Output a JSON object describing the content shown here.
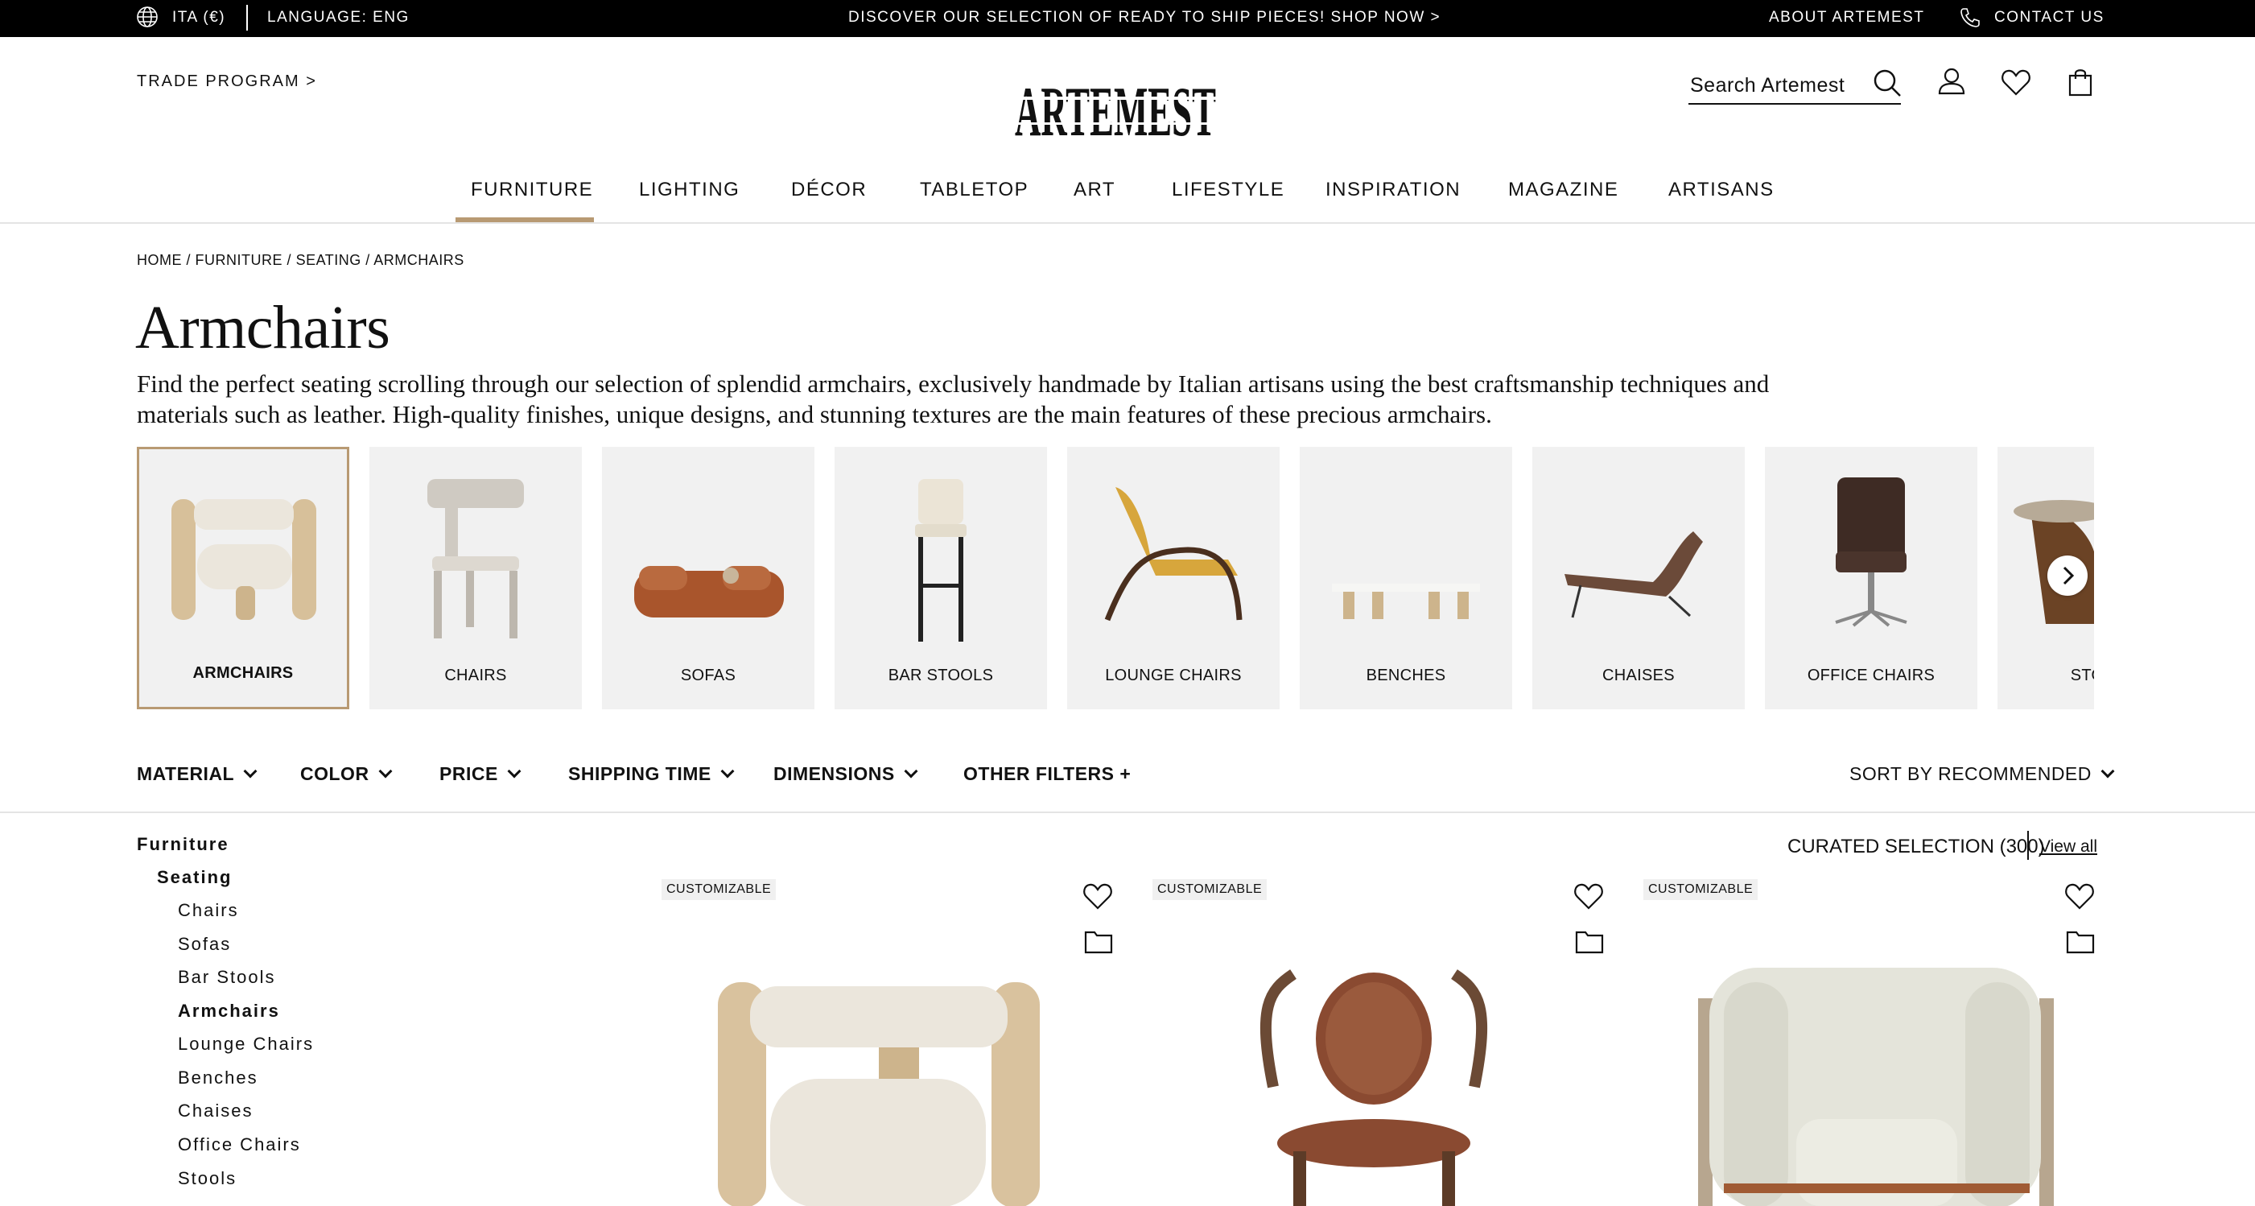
{
  "topbar": {
    "region": "ITA (€)",
    "language": "LANGUAGE: ENG",
    "promo": "DISCOVER OUR SELECTION OF READY TO SHIP PIECES! SHOP NOW >",
    "about": "ABOUT ARTEMEST",
    "contact": "CONTACT US"
  },
  "header": {
    "trade": "TRADE PROGRAM >",
    "logo": "ARTEMEST",
    "search_placeholder": "Search Artemest"
  },
  "nav": [
    "FURNITURE",
    "LIGHTING",
    "DÉCOR",
    "TABLETOP",
    "ART",
    "LIFESTYLE",
    "INSPIRATION",
    "MAGAZINE",
    "ARTISANS"
  ],
  "nav_active": "FURNITURE",
  "breadcrumb": [
    "HOME",
    "FURNITURE",
    "SEATING",
    "ARMCHAIRS"
  ],
  "page": {
    "title": "Armchairs",
    "description": "Find the perfect seating scrolling through our selection of splendid armchairs, exclusively handmade by Italian artisans using the best craftsmanship techniques and materials such as leather. High-quality finishes, unique designs, and stunning textures are the main features of these precious armchairs."
  },
  "categories": [
    "ARMCHAIRS",
    "CHAIRS",
    "SOFAS",
    "BAR STOOLS",
    "LOUNGE CHAIRS",
    "BENCHES",
    "CHAISES",
    "OFFICE CHAIRS",
    "STOOLS"
  ],
  "filters": [
    "MATERIAL",
    "COLOR",
    "PRICE",
    "SHIPPING TIME",
    "DIMENSIONS",
    "OTHER FILTERS +"
  ],
  "sort": "SORT BY RECOMMENDED",
  "sidebar": {
    "root": "Furniture",
    "group": "Seating",
    "items": [
      "Chairs",
      "Sofas",
      "Bar Stools",
      "Armchairs",
      "Lounge Chairs",
      "Benches",
      "Chaises",
      "Office Chairs",
      "Stools"
    ],
    "active": "Armchairs"
  },
  "results": {
    "curated": "CURATED SELECTION (300)",
    "view_all": "View all"
  },
  "products": [
    {
      "badge": "CUSTOMIZABLE"
    },
    {
      "badge": "CUSTOMIZABLE"
    },
    {
      "badge": "CUSTOMIZABLE"
    }
  ],
  "colors": {
    "accent": "#b89a73",
    "topbar": "#000000",
    "card_bg": "#f1f1f1"
  }
}
